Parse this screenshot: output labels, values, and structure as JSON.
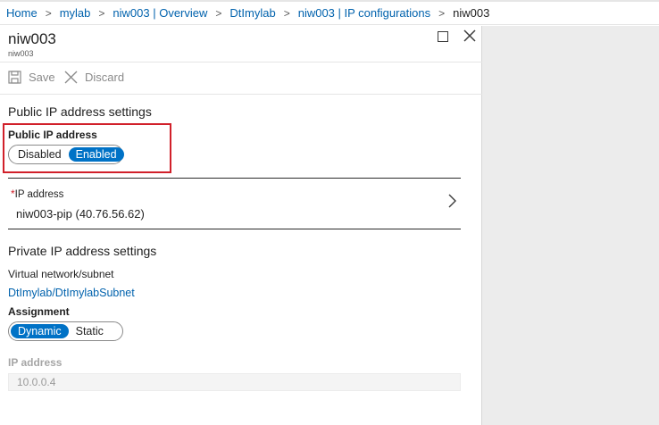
{
  "breadcrumb": {
    "items": [
      "Home",
      "mylab",
      "niw003 | Overview",
      "DtImylab",
      "niw003 | IP configurations"
    ],
    "current": "niw003"
  },
  "blade": {
    "title": "niw003",
    "subtitle": "niw003"
  },
  "toolbar": {
    "save_label": "Save",
    "discard_label": "Discard"
  },
  "public_ip": {
    "section_title": "Public IP address settings",
    "field_label": "Public IP address",
    "options": [
      "Disabled",
      "Enabled"
    ],
    "selected": "Enabled",
    "ip_address_label": "IP address",
    "ip_address_value": "niw003-pip (40.76.56.62)"
  },
  "private_ip": {
    "section_title": "Private IP address settings",
    "vnet_label": "Virtual network/subnet",
    "vnet_value": "DtImylab/DtImylabSubnet",
    "assignment_label": "Assignment",
    "assignment_options": [
      "Dynamic",
      "Static"
    ],
    "assignment_selected": "Dynamic",
    "ip_address_label": "IP address",
    "ip_address_value": "10.0.0.4"
  },
  "colors": {
    "accent": "#0072c6",
    "link": "#0062ad",
    "highlight_border": "#d1202a",
    "required_star": "#d1202a"
  }
}
